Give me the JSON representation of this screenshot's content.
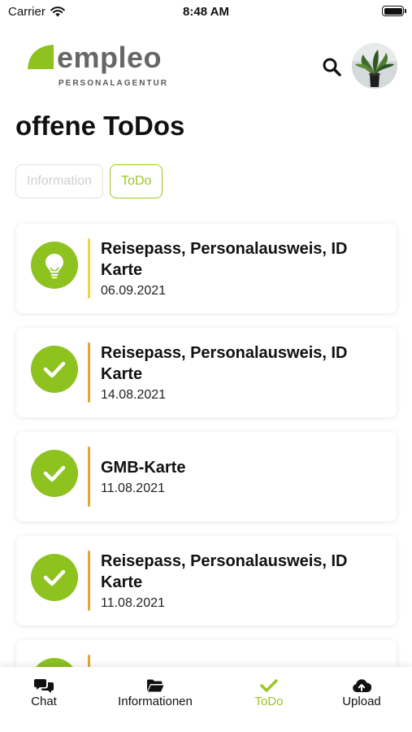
{
  "status_bar": {
    "carrier": "Carrier",
    "time": "8:48 AM"
  },
  "brand": {
    "name": "empleo",
    "tagline": "PERSONALAGENTUR",
    "accent_color": "#8dc21f"
  },
  "header": {
    "search_icon": "search-icon",
    "avatar_icon": "avatar"
  },
  "page": {
    "title": "offene ToDos"
  },
  "segments": [
    {
      "label": "Information",
      "active": false
    },
    {
      "label": "ToDo",
      "active": true
    }
  ],
  "todos": [
    {
      "title": "Reisepass, Personalausweis, ID Karte",
      "date": "06.09.2021",
      "icon": "lightbulb-icon",
      "bar_color": "#f2d23a"
    },
    {
      "title": "Reisepass, Personalausweis, ID Karte",
      "date": "14.08.2021",
      "icon": "check-icon",
      "bar_color": "#e8a52a"
    },
    {
      "title": "GMB-Karte",
      "date": "11.08.2021",
      "icon": "check-icon",
      "bar_color": "#e8a52a"
    },
    {
      "title": "Reisepass, Personalausweis, ID Karte",
      "date": "11.08.2021",
      "icon": "check-icon",
      "bar_color": "#e8a52a"
    }
  ],
  "tabs": [
    {
      "label": "Chat",
      "icon": "chat-icon",
      "active": false
    },
    {
      "label": "Informationen",
      "icon": "folder-icon",
      "active": false
    },
    {
      "label": "ToDo",
      "icon": "check-icon",
      "active": true
    },
    {
      "label": "Upload",
      "icon": "cloud-upload-icon",
      "active": false
    }
  ]
}
